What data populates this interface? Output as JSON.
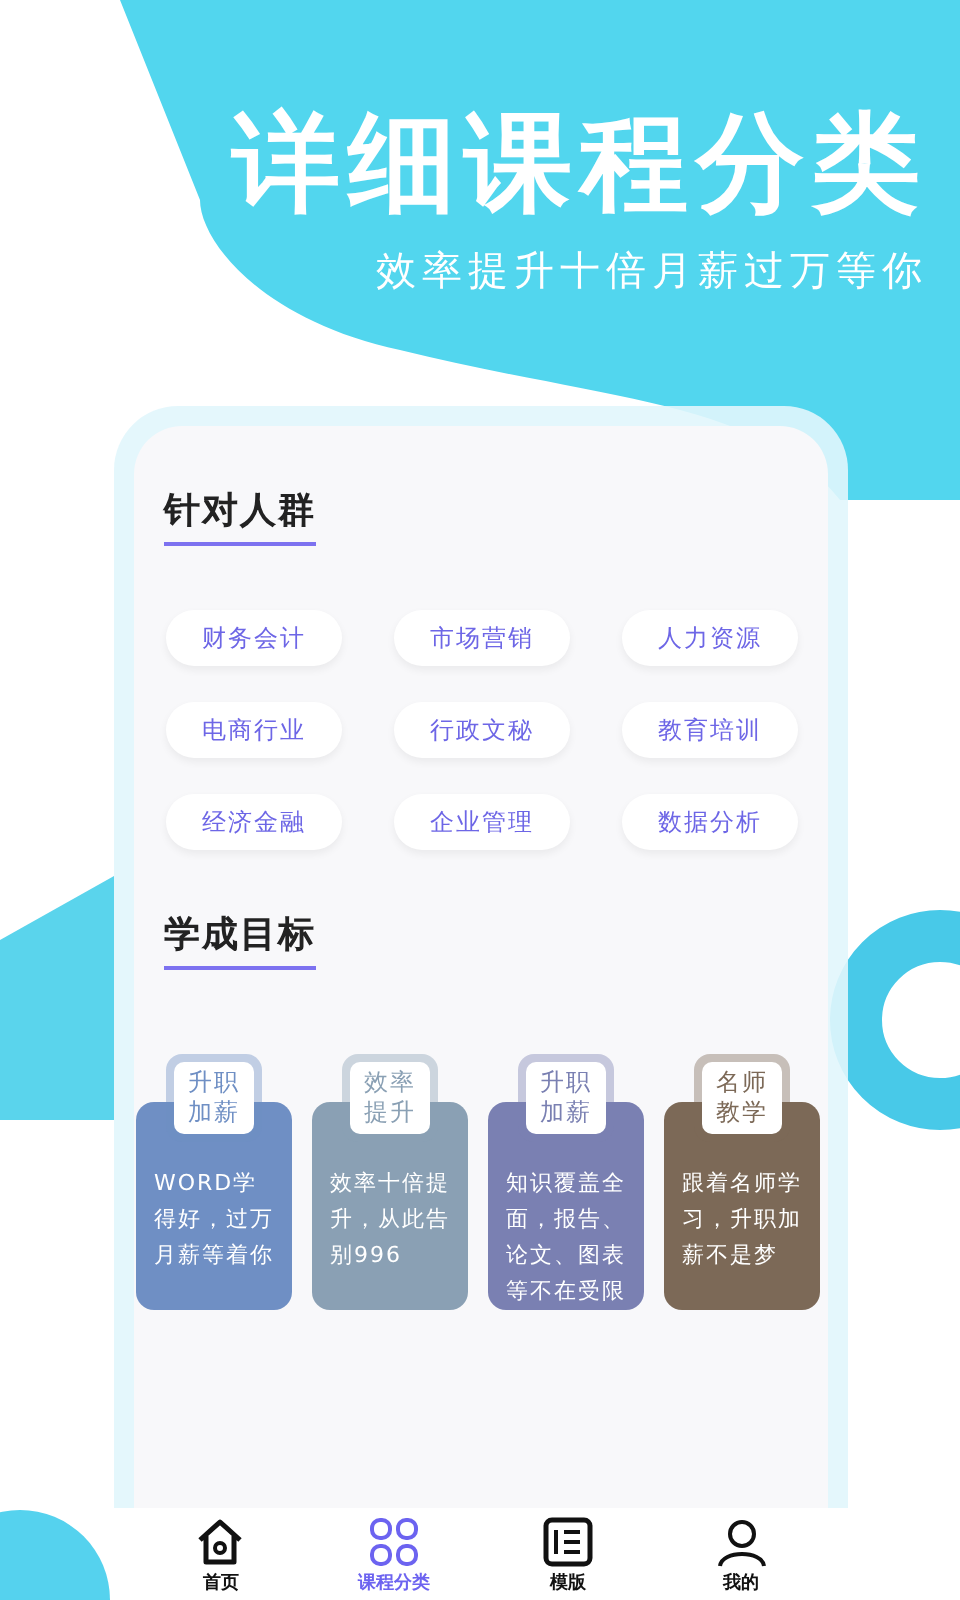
{
  "headline": "详细课程分类",
  "subtitle": "效率提升十倍月薪过万等你",
  "audience": {
    "title": "针对人群",
    "tags": [
      "财务会计",
      "市场营销",
      "人力资源",
      "电商行业",
      "行政文秘",
      "教育培训",
      "经济金融",
      "企业管理",
      "数据分析"
    ]
  },
  "goals": {
    "title": "学成目标",
    "cards": [
      {
        "badge": "升职加薪",
        "text": "WORD学得好，过万月薪等着你",
        "color": "#6f8fc4"
      },
      {
        "badge": "效率提升",
        "text": "效率十倍提升，从此告别996",
        "color": "#8aa0b4"
      },
      {
        "badge": "升职加薪",
        "text": "知识覆盖全面，报告、论文、图表等不在受限",
        "color": "#7a80b2"
      },
      {
        "badge": "名师教学",
        "text": "跟着名师学习，升职加薪不是梦",
        "color": "#7c6957"
      }
    ]
  },
  "tab_bar": [
    {
      "label": "首页",
      "selected": false
    },
    {
      "label": "课程分类",
      "selected": true
    },
    {
      "label": "模版",
      "selected": false
    },
    {
      "label": "我的",
      "selected": false
    }
  ]
}
